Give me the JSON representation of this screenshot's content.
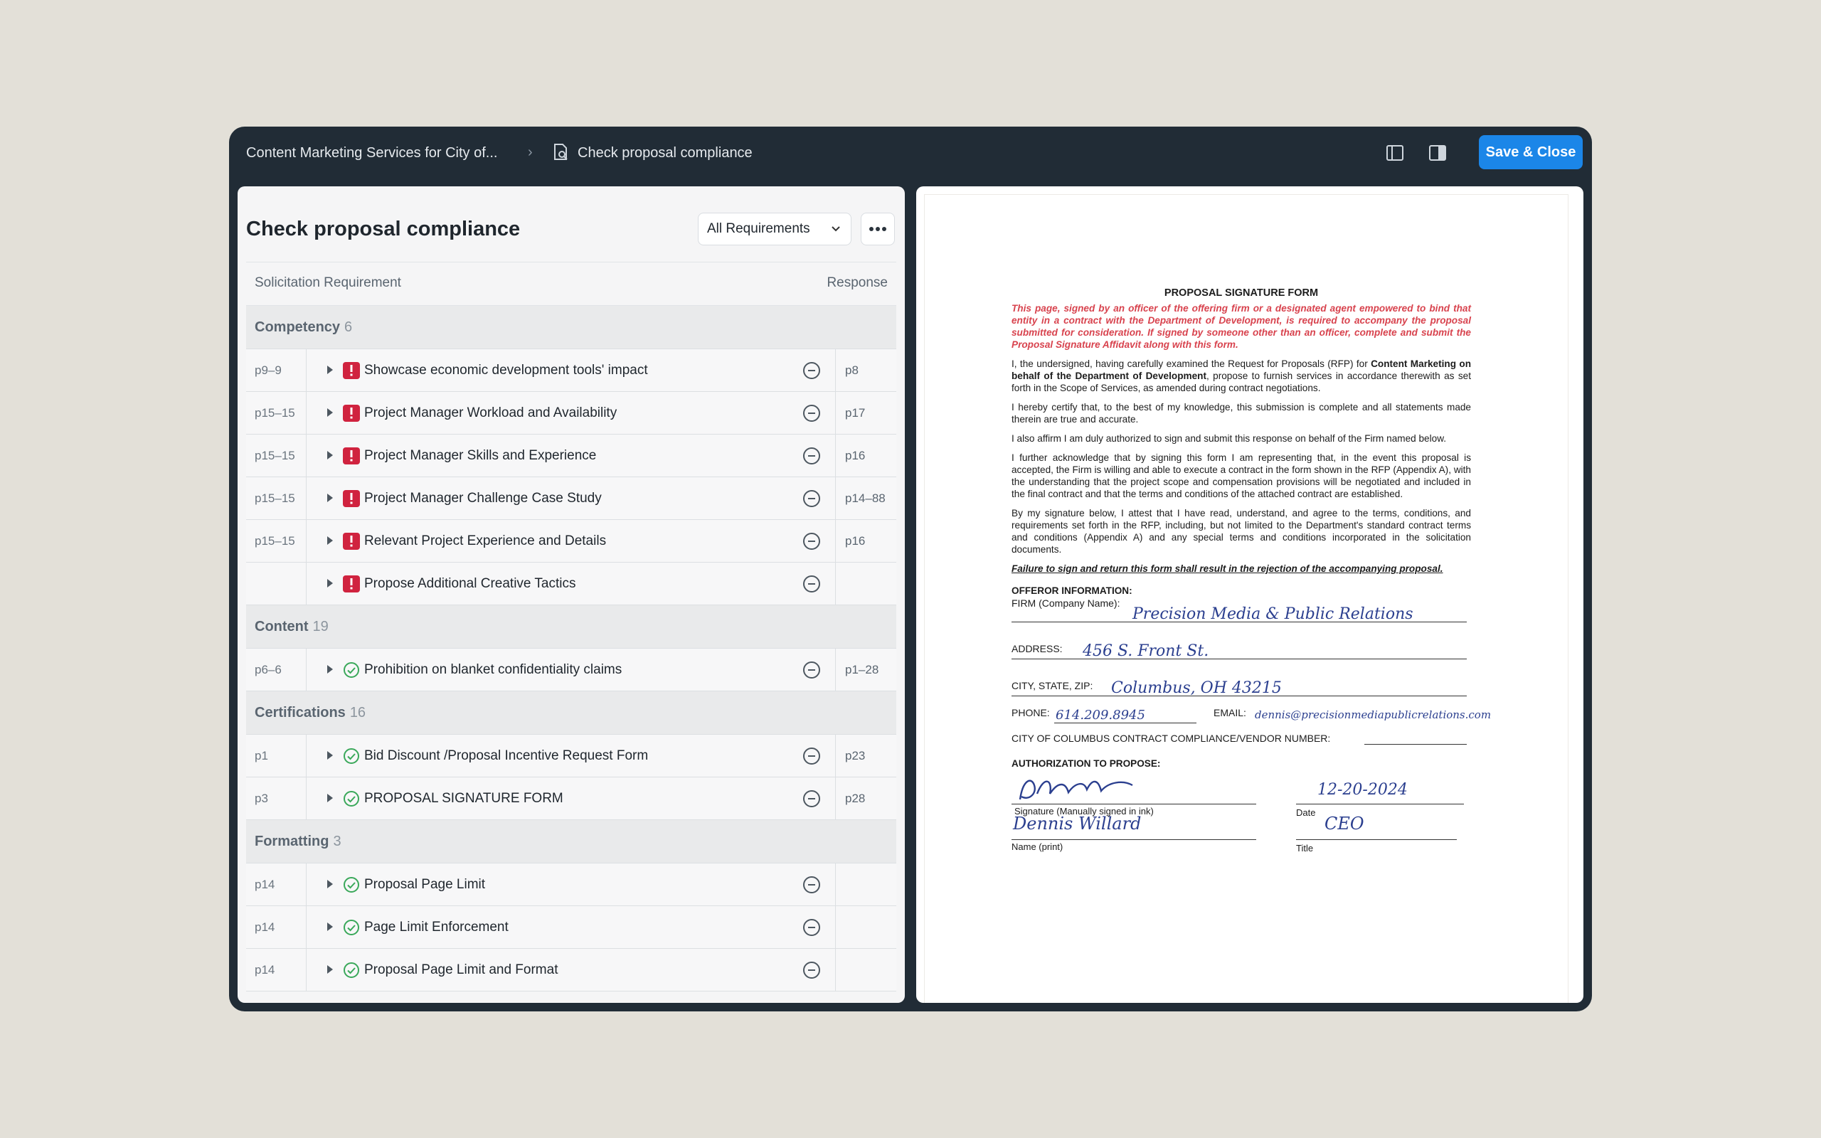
{
  "topbar": {
    "breadcrumb_parent": "Content Marketing Services for City of...",
    "breadcrumb_current": "Check proposal compliance",
    "save_label": "Save & Close"
  },
  "left": {
    "title": "Check proposal compliance",
    "filter_value": "All Requirements",
    "col_requirement": "Solicitation Requirement",
    "col_response": "Response",
    "groups": [
      {
        "name": "Competency",
        "count": "6",
        "rows": [
          {
            "pages": "p9–9",
            "status": "flag",
            "label": "Showcase economic development tools' impact",
            "response": "p8"
          },
          {
            "pages": "p15–15",
            "status": "flag",
            "label": "Project Manager Workload and Availability",
            "response": "p17"
          },
          {
            "pages": "p15–15",
            "status": "flag",
            "label": "Project Manager Skills and Experience",
            "response": "p16"
          },
          {
            "pages": "p15–15",
            "status": "flag",
            "label": "Project Manager Challenge Case Study",
            "response": "p14–88"
          },
          {
            "pages": "p15–15",
            "status": "flag",
            "label": "Relevant Project Experience and Details",
            "response": "p16"
          },
          {
            "pages": "",
            "status": "flag",
            "label": "Propose Additional Creative Tactics",
            "response": ""
          }
        ]
      },
      {
        "name": "Content",
        "count": "19",
        "rows": [
          {
            "pages": "p6–6",
            "status": "ok",
            "label": "Prohibition on blanket confidentiality claims",
            "response": "p1–28"
          }
        ]
      },
      {
        "name": "Certifications",
        "count": "16",
        "rows": [
          {
            "pages": "p1",
            "status": "ok",
            "label": "Bid Discount /Proposal Incentive Request Form",
            "response": "p23"
          },
          {
            "pages": "p3",
            "status": "ok",
            "label": "PROPOSAL SIGNATURE FORM",
            "response": "p28"
          }
        ]
      },
      {
        "name": "Formatting",
        "count": "3",
        "rows": [
          {
            "pages": "p14",
            "status": "ok",
            "label": "Proposal Page Limit",
            "response": ""
          },
          {
            "pages": "p14",
            "status": "ok",
            "label": "Page Limit Enforcement",
            "response": ""
          },
          {
            "pages": "p14",
            "status": "ok",
            "label": "Proposal Page Limit and Format",
            "response": ""
          }
        ]
      }
    ]
  },
  "doc": {
    "title": "PROPOSAL SIGNATURE FORM",
    "red_notice": "This page, signed by an officer of the offering firm or a designated agent empowered to bind that entity in a contract with the Department of Development, is required to accompany the proposal submitted for consideration. If signed by someone other than an officer, complete and submit the Proposal Signature Affidavit along with this form.",
    "para1_a": "I, the undersigned, having carefully examined the Request for Proposals (RFP) for ",
    "para1_b": "Content Marketing on behalf of the Department of Development",
    "para1_c": ", propose to furnish services in accordance therewith as set forth in the Scope of Services, as amended during contract negotiations.",
    "para2": "I hereby certify that, to the best of my knowledge, this submission is complete and all statements made therein are true and accurate.",
    "para3": "I also affirm I am duly authorized to sign and submit this response on behalf of the Firm named below.",
    "para4": "I further acknowledge that by signing this form I am representing that, in the event this proposal is accepted, the Firm is willing and able to execute a contract in the form shown in the RFP (Appendix A), with the understanding that the project scope and compensation provisions will be negotiated and included in the final contract and that the terms and conditions of the attached contract are established.",
    "para5": "By my signature below, I attest that I have read, understand, and agree to the terms, conditions, and requirements set forth in the RFP, including, but not limited to the Department's standard contract terms and conditions (Appendix A) and any special terms and conditions incorporated in the solicitation documents.",
    "warning": "Failure to sign and return this form shall result in the rejection of the accompanying proposal.",
    "offeror_heading": "OFFEROR INFORMATION:",
    "firm_label": "FIRM (Company Name):",
    "firm_value": "Precision Media & Public Relations",
    "address_label": "ADDRESS:",
    "address_value": "456 S. Front St.",
    "city_label": "CITY, STATE, ZIP:",
    "city_value": "Columbus, OH 43215",
    "phone_label": "PHONE:",
    "phone_value": "614.209.8945",
    "email_label": "EMAIL:",
    "email_value": "dennis@precisionmediapublicrelations.com",
    "vendor_label": "CITY OF COLUMBUS CONTRACT COMPLIANCE/VENDOR NUMBER:",
    "auth_heading": "AUTHORIZATION TO PROPOSE:",
    "sig_caption": "Signature (Manually signed in ink)",
    "date_caption": "Date",
    "date_value": "12-20-2024",
    "name_caption": "Name (print)",
    "name_value": "Dennis Willard",
    "title_caption": "Title",
    "title_value": "CEO"
  }
}
